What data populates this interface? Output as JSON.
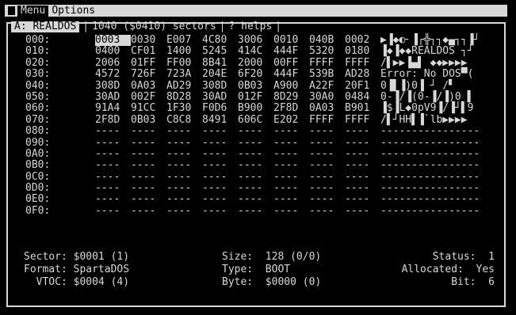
{
  "menubar": {
    "menu_label": "Menu",
    "options_label": "Options"
  },
  "header": {
    "drive": "A: REALDOS",
    "sectors": "1040 ($0410) sectors",
    "help": "? helps"
  },
  "rows": [
    {
      "addr": "000:",
      "hex": [
        "0003",
        "0030",
        "E007",
        "4C80",
        "3006",
        "0010",
        "040B",
        "0002"
      ],
      "ascii": "▶▐◆◐╴▐┌╬┐┐◆▄┐┐▐┘"
    },
    {
      "addr": "010:",
      "hex": [
        "0400",
        "CF01",
        "1400",
        "5245",
        "414C",
        "444F",
        "5320",
        "0180"
      ],
      "ascii": "▐◆▐◆◆REALDOS ┐┘"
    },
    {
      "addr": "020:",
      "hex": [
        "2006",
        "01FF",
        "FF00",
        "8B41",
        "2000",
        "00FF",
        "FFFF",
        "FFFF"
      ],
      "ascii": "/▌▶▶▐▄▌ ◆◆▶▶▶▶"
    },
    {
      "addr": "030:",
      "hex": [
        "4572",
        "726F",
        "723A",
        "204E",
        "6F20",
        "444F",
        "539B",
        "AD28"
      ],
      "ascii": "Error: No DOS▀("
    },
    {
      "addr": "040:",
      "hex": [
        "308D",
        "0A03",
        "AD29",
        "308D",
        "0B03",
        "A900",
        "A22F",
        "20F1"
      ],
      "ascii": "0▐▌▐)0▐ ┘ /▘"
    },
    {
      "addr": "050:",
      "hex": [
        "30AD",
        "002F",
        "8D28",
        "30AD",
        "012F",
        "8D29",
        "30A0",
        "0484"
      ],
      "ascii": "0-▐/▐(0-▐/▐)0 ▌"
    },
    {
      "addr": "060:",
      "hex": [
        "91A4",
        "91CC",
        "1F30",
        "F0D6",
        "B900",
        "2F8D",
        "0A03",
        "B901"
      ],
      "ascii": "▐$▐L◆0pV9▐/▐┘▌9"
    },
    {
      "addr": "070:",
      "hex": [
        "2F8D",
        "0B03",
        "C8C8",
        "8491",
        "606C",
        "E202",
        "FFFF",
        "FFFF"
      ],
      "ascii": "/▌┘HH▌▐`lb▶▶▶▶"
    },
    {
      "addr": "080:",
      "hex": [
        "----",
        "----",
        "----",
        "----",
        "----",
        "----",
        "----",
        "----"
      ],
      "ascii": "----------------"
    },
    {
      "addr": "090:",
      "hex": [
        "----",
        "----",
        "----",
        "----",
        "----",
        "----",
        "----",
        "----"
      ],
      "ascii": "----------------"
    },
    {
      "addr": "0A0:",
      "hex": [
        "----",
        "----",
        "----",
        "----",
        "----",
        "----",
        "----",
        "----"
      ],
      "ascii": "----------------"
    },
    {
      "addr": "0B0:",
      "hex": [
        "----",
        "----",
        "----",
        "----",
        "----",
        "----",
        "----",
        "----"
      ],
      "ascii": "----------------"
    },
    {
      "addr": "0C0:",
      "hex": [
        "----",
        "----",
        "----",
        "----",
        "----",
        "----",
        "----",
        "----"
      ],
      "ascii": "----------------"
    },
    {
      "addr": "0D0:",
      "hex": [
        "----",
        "----",
        "----",
        "----",
        "----",
        "----",
        "----",
        "----"
      ],
      "ascii": "----------------"
    },
    {
      "addr": "0E0:",
      "hex": [
        "----",
        "----",
        "----",
        "----",
        "----",
        "----",
        "----",
        "----"
      ],
      "ascii": "----------------"
    },
    {
      "addr": "0F0:",
      "hex": [
        "----",
        "----",
        "----",
        "----",
        "----",
        "----",
        "----",
        "----"
      ],
      "ascii": "----------------"
    }
  ],
  "info": {
    "sector_label": "Sector:",
    "sector_value": "$0001 (1)",
    "format_label": "Format:",
    "format_value": "SpartaDOS",
    "vtoc_label": "VTOC:",
    "vtoc_value": "$0004 (4)",
    "size_label": "Size:",
    "size_value": "128 (0/0)",
    "type_label": "Type:",
    "type_value": "BOOT",
    "byte_label": "Byte:",
    "byte_value": "$0000 (0)",
    "status_label": "Status:",
    "status_value": "1",
    "allocated_label": "Allocated:",
    "allocated_value": "Yes",
    "bit_label": "Bit:",
    "bit_value": "6"
  },
  "colors": {
    "background": "#000000",
    "foreground": "#d8d8d8"
  }
}
